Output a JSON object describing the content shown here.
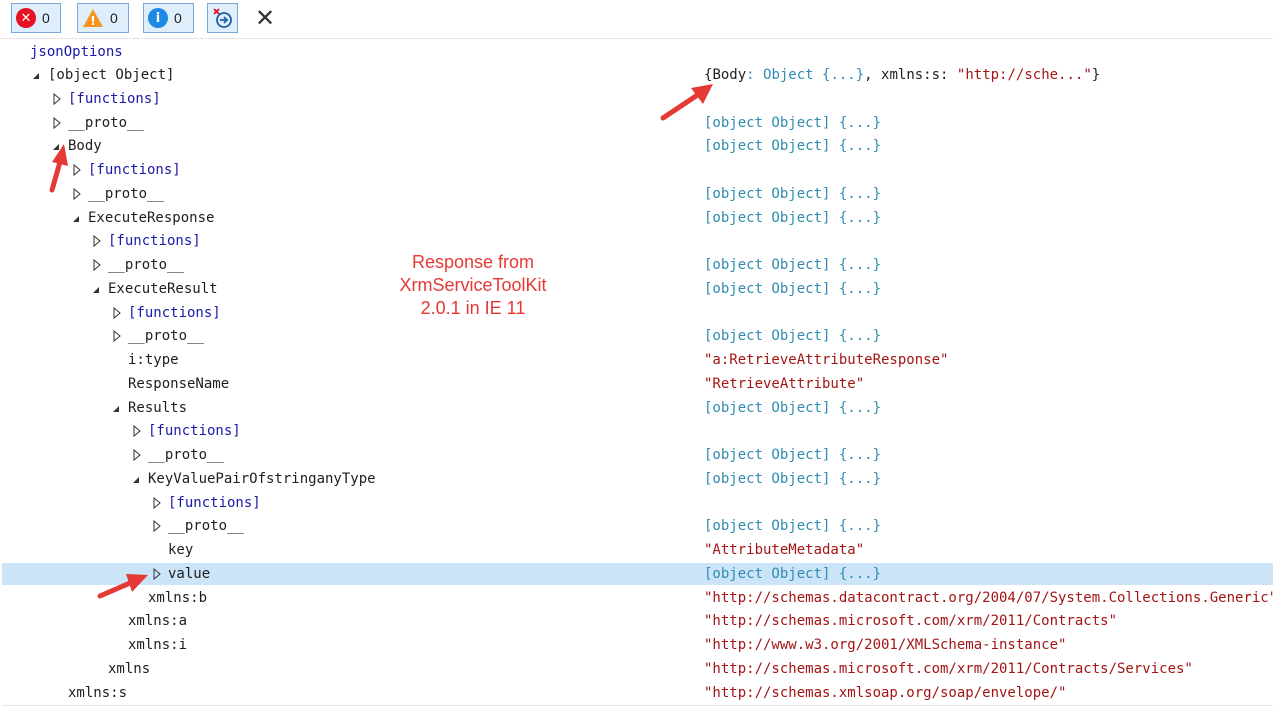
{
  "toolbar": {
    "errors": "0",
    "warnings": "0",
    "info": "0",
    "error_icon": "error-icon",
    "warning_icon": "warning-icon",
    "info_icon": "info-icon",
    "clear_icon": "clear-icon",
    "close_icon": "close-icon"
  },
  "root_label": "jsonOptions",
  "tree": [
    {
      "label": "[object Object]",
      "value": "",
      "kind": "none"
    },
    {
      "label": "[functions]",
      "value": "",
      "kind": "none"
    },
    {
      "label": "__proto__",
      "value": "[object Object] {...}",
      "kind": "obj"
    },
    {
      "label": "Body",
      "value": "[object Object] {...}",
      "kind": "obj"
    },
    {
      "label": "[functions]",
      "value": "",
      "kind": "none"
    },
    {
      "label": "__proto__",
      "value": "[object Object] {...}",
      "kind": "obj"
    },
    {
      "label": "ExecuteResponse",
      "value": "[object Object] {...}",
      "kind": "obj"
    },
    {
      "label": "[functions]",
      "value": "",
      "kind": "none"
    },
    {
      "label": "__proto__",
      "value": "[object Object] {...}",
      "kind": "obj"
    },
    {
      "label": "ExecuteResult",
      "value": "[object Object] {...}",
      "kind": "obj"
    },
    {
      "label": "[functions]",
      "value": "",
      "kind": "none"
    },
    {
      "label": "__proto__",
      "value": "[object Object] {...}",
      "kind": "obj"
    },
    {
      "label": "i:type",
      "value": "\"a:RetrieveAttributeResponse\"",
      "kind": "str"
    },
    {
      "label": "ResponseName",
      "value": "\"RetrieveAttribute\"",
      "kind": "str"
    },
    {
      "label": "Results",
      "value": "[object Object] {...}",
      "kind": "obj"
    },
    {
      "label": "[functions]",
      "value": "",
      "kind": "none"
    },
    {
      "label": "__proto__",
      "value": "[object Object] {...}",
      "kind": "obj"
    },
    {
      "label": "KeyValuePairOfstringanyType",
      "value": "[object Object] {...}",
      "kind": "obj"
    },
    {
      "label": "[functions]",
      "value": "",
      "kind": "none"
    },
    {
      "label": "__proto__",
      "value": "[object Object] {...}",
      "kind": "obj"
    },
    {
      "label": "key",
      "value": "\"AttributeMetadata\"",
      "kind": "str"
    },
    {
      "label": "value",
      "value": "[object Object] {...}",
      "kind": "obj"
    },
    {
      "label": "xmlns:b",
      "value": "\"http://schemas.datacontract.org/2004/07/System.Collections.Generic\"",
      "kind": "str"
    },
    {
      "label": "xmlns:a",
      "value": "\"http://schemas.microsoft.com/xrm/2011/Contracts\"",
      "kind": "str"
    },
    {
      "label": "xmlns:i",
      "value": "\"http://www.w3.org/2001/XMLSchema-instance\"",
      "kind": "str"
    },
    {
      "label": "xmlns",
      "value": "\"http://schemas.microsoft.com/xrm/2011/Contracts/Services\"",
      "kind": "str"
    },
    {
      "label": "xmlns:s",
      "value": "\"http://schemas.xmlsoap.org/soap/envelope/\"",
      "kind": "str"
    }
  ],
  "root_summary": {
    "open": "{",
    "k1": "Body",
    "sep1": ": ",
    "v1": "Object {...}",
    "comma": ", ",
    "k2": "xmlns:s",
    "sep2": ": ",
    "v2": "\"http://sche...\"",
    "close": "}"
  },
  "annotation": {
    "line1": "Response from",
    "line2": "XrmServiceToolKit",
    "line3": "2.0.1 in IE 11"
  },
  "colors": {
    "selection": "#cce4f7",
    "object_value": "#2f8cb0",
    "string_value": "#a31515",
    "functions": "#1a1aa6",
    "annotation": "#e53935"
  }
}
